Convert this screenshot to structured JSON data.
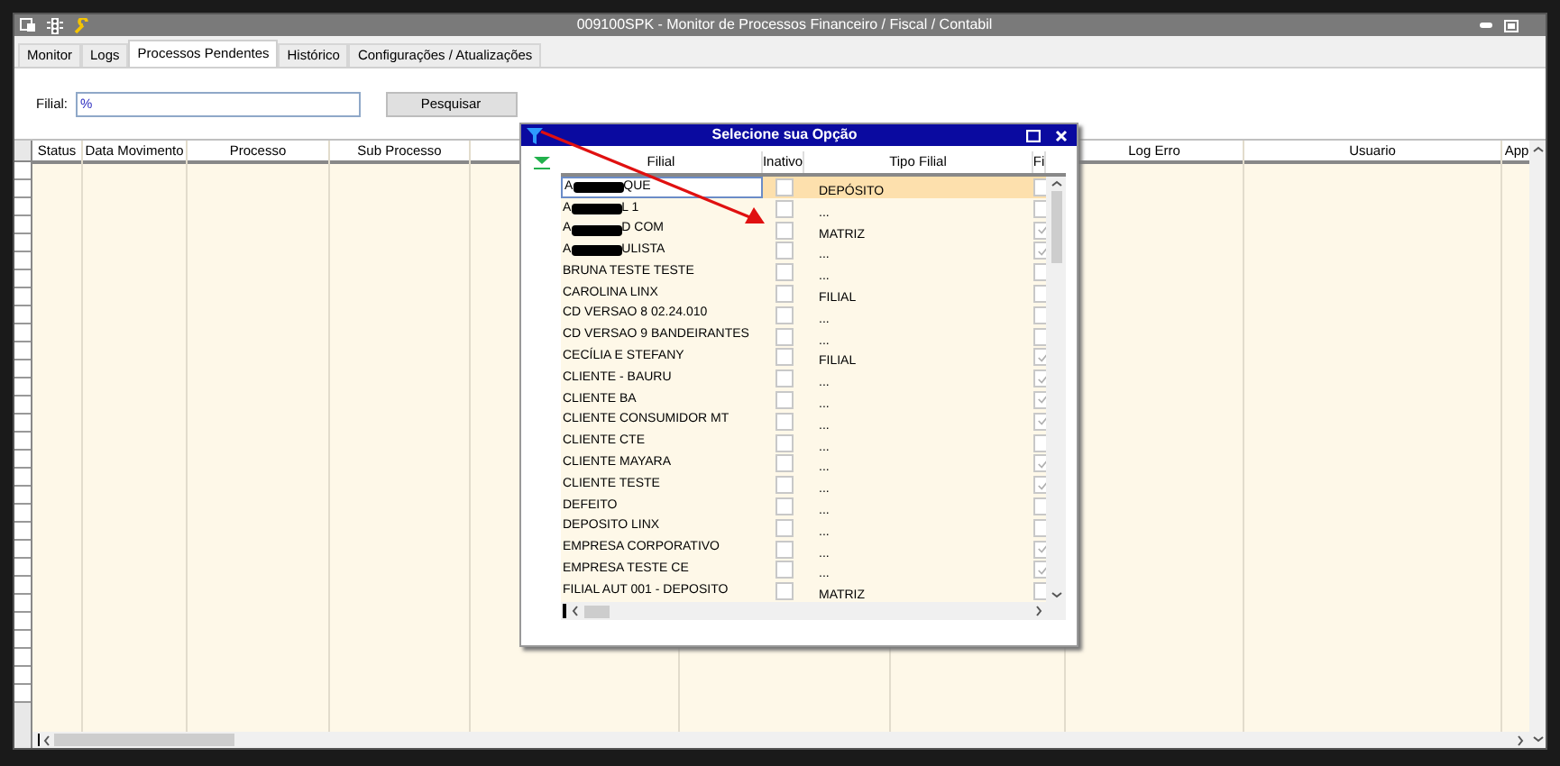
{
  "window": {
    "title": "009100SPK - Monitor de Processos Financeiro / Fiscal / Contabil"
  },
  "tabs": [
    {
      "label": "Monitor",
      "selected": false
    },
    {
      "label": "Logs",
      "selected": false
    },
    {
      "label": "Processos Pendentes",
      "selected": true
    },
    {
      "label": "Histórico",
      "selected": false
    },
    {
      "label": "Configurações / Atualizações",
      "selected": false
    }
  ],
  "filter": {
    "label": "Filial:",
    "value": "%"
  },
  "search_button": "Pesquisar",
  "table": {
    "columns": [
      {
        "kind": "text",
        "label": "Status"
      },
      {
        "kind": "text",
        "label": "Data Movimento"
      },
      {
        "kind": "text",
        "label": "Processo"
      },
      {
        "kind": "text",
        "label": "Sub Processo"
      },
      {
        "kind": "blank"
      },
      {
        "kind": "blank"
      },
      {
        "kind": "blank"
      },
      {
        "kind": "text",
        "label": "Log Erro"
      },
      {
        "kind": "text",
        "label": "Usuario"
      },
      {
        "kind": "text",
        "label": "App"
      }
    ]
  },
  "dialog": {
    "title": "Selecione sua Opção",
    "columns": [
      "Filial",
      "Inativo",
      "Tipo Filial",
      "Fi"
    ],
    "rows": [
      {
        "kind": "redacted",
        "filial_start": "A",
        "filial_end": "QUE",
        "inativo": false,
        "tipo": "DEPÓSITO",
        "fi": false,
        "selected": true
      },
      {
        "kind": "redacted",
        "filial_start": "A",
        "filial_end": "L 1",
        "inativo": false,
        "tipo": "...",
        "fi": false,
        "selected": false
      },
      {
        "kind": "redacted",
        "filial_start": "A",
        "filial_end": "D COM",
        "inativo": false,
        "tipo": "MATRIZ",
        "fi": true,
        "selected": false
      },
      {
        "kind": "redacted",
        "filial_start": "A",
        "filial_end": "ULISTA",
        "inativo": false,
        "tipo": "...",
        "fi": true,
        "selected": false
      },
      {
        "kind": "plain",
        "filial": "BRUNA TESTE TESTE",
        "inativo": false,
        "tipo": "...",
        "fi": false,
        "selected": false
      },
      {
        "kind": "plain",
        "filial": "CAROLINA LINX",
        "inativo": false,
        "tipo": "FILIAL",
        "fi": false,
        "selected": false
      },
      {
        "kind": "plain",
        "filial": "CD VERSAO 8 02.24.010",
        "inativo": false,
        "tipo": "...",
        "fi": false,
        "selected": false
      },
      {
        "kind": "plain",
        "filial": "CD VERSAO 9 BANDEIRANTES",
        "inativo": false,
        "tipo": "...",
        "fi": false,
        "selected": false
      },
      {
        "kind": "plain",
        "filial": "CECÍLIA E STEFANY",
        "inativo": false,
        "tipo": "FILIAL",
        "fi": true,
        "selected": false
      },
      {
        "kind": "plain",
        "filial": "CLIENTE - BAURU",
        "inativo": false,
        "tipo": "...",
        "fi": true,
        "selected": false
      },
      {
        "kind": "plain",
        "filial": "CLIENTE BA",
        "inativo": false,
        "tipo": "...",
        "fi": true,
        "selected": false
      },
      {
        "kind": "plain",
        "filial": "CLIENTE CONSUMIDOR MT",
        "inativo": false,
        "tipo": "...",
        "fi": true,
        "selected": false
      },
      {
        "kind": "plain",
        "filial": "CLIENTE CTE",
        "inativo": false,
        "tipo": "...",
        "fi": false,
        "selected": false
      },
      {
        "kind": "plain",
        "filial": "CLIENTE MAYARA",
        "inativo": false,
        "tipo": "...",
        "fi": true,
        "selected": false
      },
      {
        "kind": "plain",
        "filial": "CLIENTE TESTE",
        "inativo": false,
        "tipo": "...",
        "fi": true,
        "selected": false
      },
      {
        "kind": "plain",
        "filial": "DEFEITO",
        "inativo": false,
        "tipo": "...",
        "fi": false,
        "selected": false
      },
      {
        "kind": "plain",
        "filial": "DEPOSITO LINX",
        "inativo": false,
        "tipo": "...",
        "fi": false,
        "selected": false
      },
      {
        "kind": "plain",
        "filial": "EMPRESA CORPORATIVO",
        "inativo": false,
        "tipo": "...",
        "fi": true,
        "selected": false
      },
      {
        "kind": "plain",
        "filial": "EMPRESA TESTE CE",
        "inativo": false,
        "tipo": "...",
        "fi": true,
        "selected": false
      },
      {
        "kind": "plain",
        "filial": "FILIAL AUT 001 - DEPOSITO",
        "inativo": false,
        "tipo": "MATRIZ",
        "fi": false,
        "selected": false
      }
    ]
  }
}
